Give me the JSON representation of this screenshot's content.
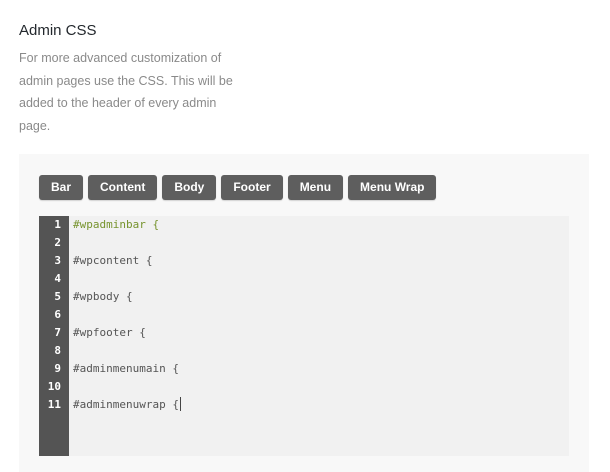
{
  "section": {
    "title": "Admin CSS",
    "description": "For more advanced customization of admin pages use the CSS. This will be added to the header of every admin page."
  },
  "buttons": [
    {
      "label": "Bar"
    },
    {
      "label": "Content"
    },
    {
      "label": "Body"
    },
    {
      "label": "Footer"
    },
    {
      "label": "Menu"
    },
    {
      "label": "Menu Wrap"
    }
  ],
  "editor": {
    "lines": [
      {
        "number": "1",
        "text": "#wpadminbar {"
      },
      {
        "number": "2",
        "text": ""
      },
      {
        "number": "3",
        "text": "#wpcontent {"
      },
      {
        "number": "4",
        "text": ""
      },
      {
        "number": "5",
        "text": "#wpbody {"
      },
      {
        "number": "6",
        "text": ""
      },
      {
        "number": "7",
        "text": "#wpfooter {"
      },
      {
        "number": "8",
        "text": ""
      },
      {
        "number": "9",
        "text": "#adminmenumain {"
      },
      {
        "number": "10",
        "text": ""
      },
      {
        "number": "11",
        "text": "#adminmenuwrap {"
      }
    ]
  },
  "colors": {
    "button_bg": "#5e5e5e",
    "gutter_bg": "#545454",
    "editor_bg": "#f1f1f1",
    "selector_highlight": "#77942e"
  }
}
